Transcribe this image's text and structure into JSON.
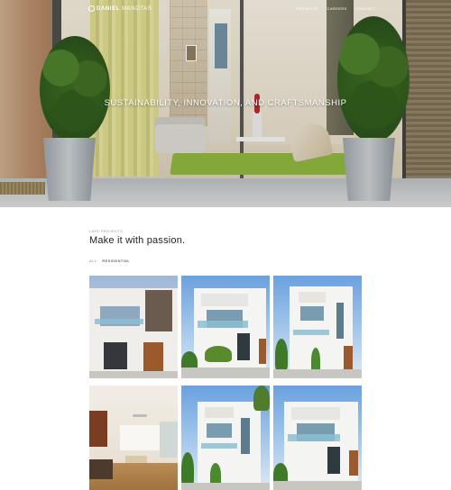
{
  "brand": {
    "name_bold": "DANIEL",
    "name_light": "MANOTAS"
  },
  "nav": {
    "items": [
      {
        "label": "Projects"
      },
      {
        "label": "Careers"
      },
      {
        "label": "Contact"
      }
    ]
  },
  "hero": {
    "tagline": "SUSTAINABILITY, INNOVATION, AND CRAFTSMANSHIP"
  },
  "section": {
    "eyebrow": "LATE PROJECTS",
    "heading": "Make it with passion.",
    "filters": [
      {
        "label": "ALL",
        "active": false
      },
      {
        "label": "RESIDENTIAL",
        "active": true
      }
    ]
  },
  "gallery": {
    "tiles": [
      {
        "kind": "building-modern"
      },
      {
        "kind": "building-balcony"
      },
      {
        "kind": "building-tall"
      },
      {
        "kind": "interior-kitchen"
      },
      {
        "kind": "building-tall"
      },
      {
        "kind": "building-balcony"
      }
    ]
  }
}
